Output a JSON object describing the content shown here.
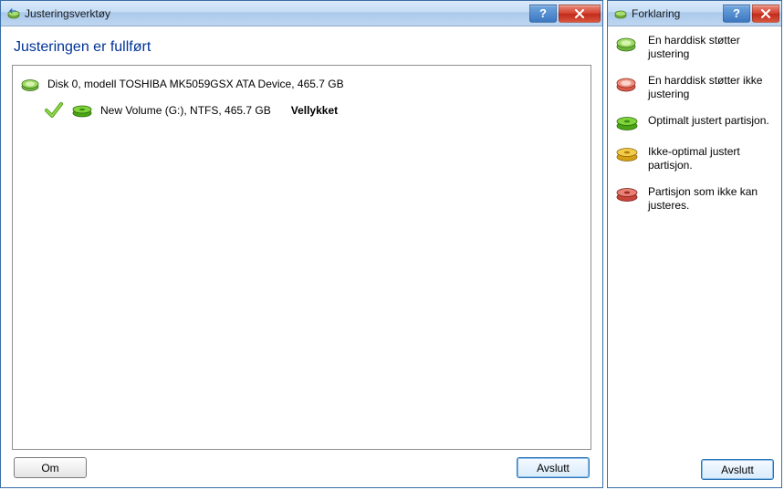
{
  "main": {
    "title": "Justeringsverktøy",
    "heading": "Justeringen er fullført",
    "disk": {
      "label": "Disk 0, modell TOSHIBA MK5059GSX ATA Device, 465.7 GB",
      "volume": {
        "label": "New Volume (G:), NTFS,  465.7 GB",
        "status": "Vellykket"
      }
    },
    "buttons": {
      "about": "Om",
      "close": "Avslutt"
    }
  },
  "side": {
    "title": "Forklaring",
    "items": [
      {
        "text": "En harddisk støtter justering"
      },
      {
        "text": "En harddisk støtter ikke justering"
      },
      {
        "text": "Optimalt justert partisjon."
      },
      {
        "text": "Ikke-optimal justert partisjon."
      },
      {
        "text": "Partisjon som ikke kan justeres."
      }
    ],
    "button": "Avslutt"
  },
  "titlebuttons": {
    "help": "?",
    "close": "x"
  }
}
